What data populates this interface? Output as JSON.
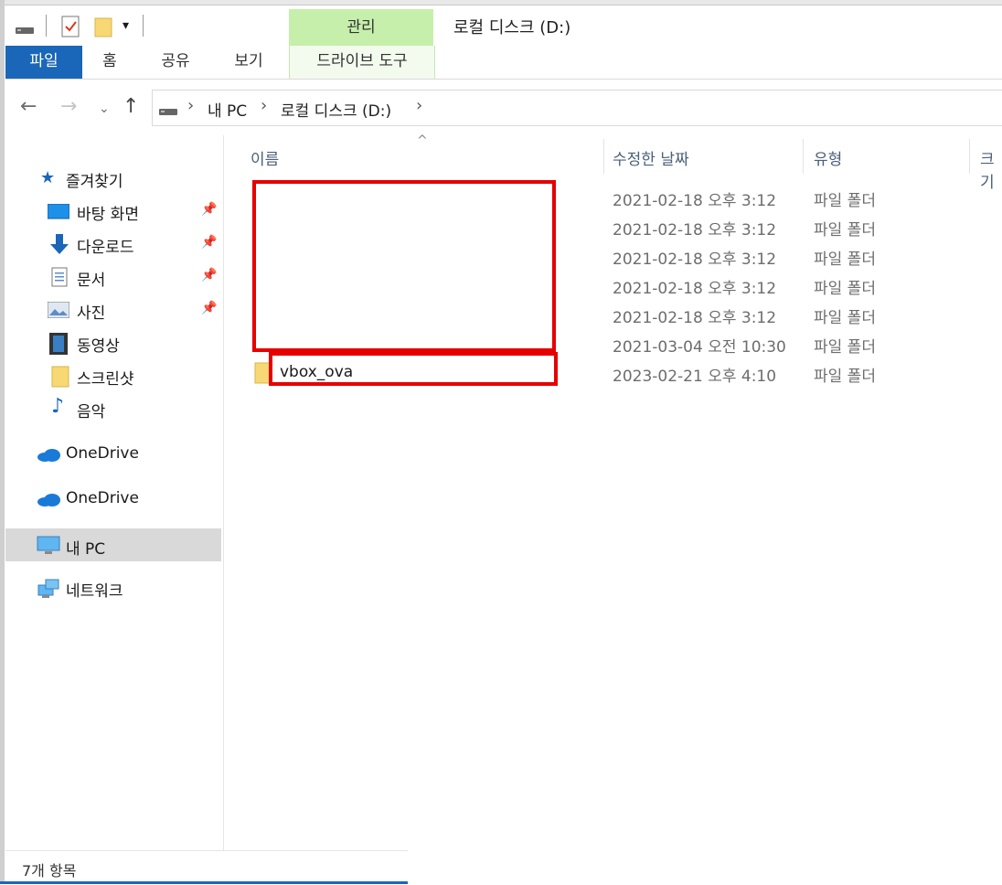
{
  "window": {
    "title": "로컬 디스크 (D:)",
    "context_tab_group": "관리"
  },
  "ribbon": {
    "tabs": [
      {
        "label": "파일",
        "active": true
      },
      {
        "label": "홈"
      },
      {
        "label": "공유"
      },
      {
        "label": "보기"
      },
      {
        "label": "드라이브 도구"
      }
    ]
  },
  "address": {
    "breadcrumbs": [
      "내 PC",
      "로컬 디스크 (D:)"
    ]
  },
  "nav_pane": {
    "quick_access": "즐겨찾기",
    "quick_items": [
      {
        "label": "바탕 화면",
        "pinned": true
      },
      {
        "label": "다운로드",
        "pinned": true
      },
      {
        "label": "문서",
        "pinned": true
      },
      {
        "label": "사진",
        "pinned": true
      },
      {
        "label": "동영상"
      },
      {
        "label": "스크린샷"
      },
      {
        "label": "음악"
      }
    ],
    "onedrive_1": "OneDrive",
    "onedrive_2": "OneDrive",
    "this_pc": "내 PC",
    "network": "네트워크"
  },
  "columns": {
    "name": "이름",
    "date": "수정한 날짜",
    "type": "유형",
    "size": "크기"
  },
  "files": [
    {
      "name": "",
      "date": "2021-02-18 오후 3:12",
      "type": "파일 폴더"
    },
    {
      "name": "",
      "date": "2021-02-18 오후 3:12",
      "type": "파일 폴더"
    },
    {
      "name": "",
      "date": "2021-02-18 오후 3:12",
      "type": "파일 폴더"
    },
    {
      "name": "",
      "date": "2021-02-18 오후 3:12",
      "type": "파일 폴더"
    },
    {
      "name": "",
      "date": "2021-02-18 오후 3:12",
      "type": "파일 폴더"
    },
    {
      "name": "",
      "date": "2021-03-04 오전 10:30",
      "type": "파일 폴더"
    },
    {
      "name": "vbox_ova",
      "date": "2023-02-21 오후 4:10",
      "type": "파일 폴더"
    }
  ],
  "status": {
    "item_count": "7개 항목"
  },
  "colors": {
    "accent": "#1a66b8",
    "context_tab": "#c6efab",
    "highlight_box": "#e60000",
    "selected_nav": "#d9d9d9"
  }
}
